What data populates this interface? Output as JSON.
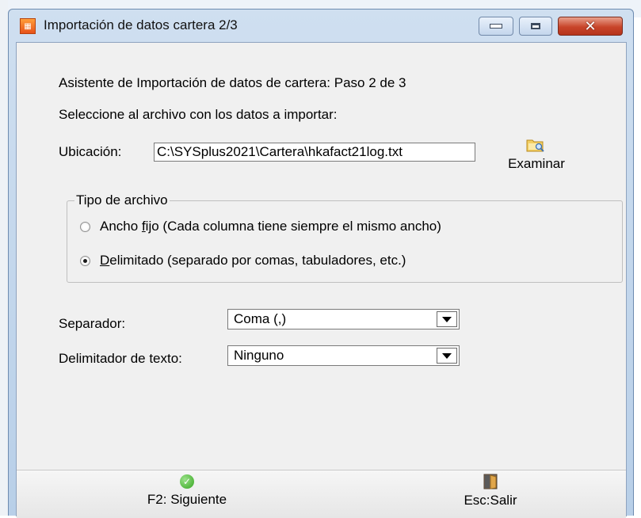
{
  "window": {
    "title": "Importación de datos cartera 2/3",
    "buttons": {
      "minimize": "minimize",
      "maximize": "maximize",
      "close": "close"
    }
  },
  "content": {
    "step_text": "Asistente de Importación de datos de cartera: Paso 2 de 3",
    "select_prompt": "Seleccione al archivo con los datos a importar:",
    "location_label": "Ubicación:",
    "location_value": "C:\\SYSplus2021\\Cartera\\hkafact21log.txt",
    "browse_label": "Examinar"
  },
  "file_type": {
    "title": "Tipo de archivo",
    "options": [
      {
        "prefix": "Ancho ",
        "mnemonic": "f",
        "rest": "ijo (Cada columna tiene siempre el mismo ancho)",
        "checked": false
      },
      {
        "prefix": "",
        "mnemonic": "D",
        "rest": "elimitado (separado por comas, tabuladores, etc.)",
        "checked": true
      }
    ]
  },
  "separator": {
    "label": "Separador:",
    "value": "Coma (,)"
  },
  "text_delimiter": {
    "label": "Delimitador de texto:",
    "value": "Ninguno"
  },
  "footer": {
    "next_label": "F2: Siguiente",
    "exit_label": "Esc:Salir"
  },
  "icons": {
    "app": "app-icon",
    "browse": "folder-search-icon",
    "next": "check-circle-icon",
    "exit": "door-exit-icon"
  },
  "colors": {
    "title_bar": "#c4d6ec",
    "close_button": "#c8452a",
    "client_bg": "#f0f0f0"
  }
}
